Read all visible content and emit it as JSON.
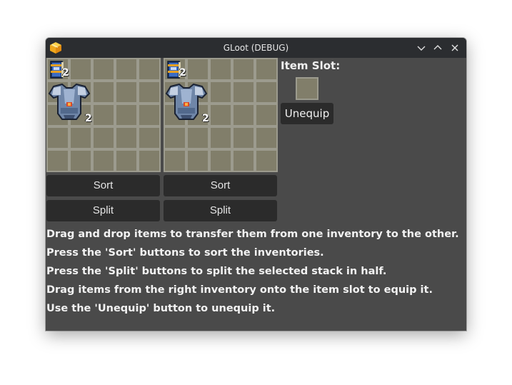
{
  "window": {
    "title": "GLoot (DEBUG)",
    "app_icon": "cube-icon",
    "controls": [
      "minimize-icon",
      "maximize-icon",
      "close-icon"
    ]
  },
  "inventories": {
    "left": {
      "columns": 5,
      "rows": 5,
      "items": [
        {
          "icon": "book-icon",
          "count": "2"
        },
        {
          "icon": "armor-icon",
          "count": "2"
        }
      ],
      "sort_label": "Sort",
      "split_label": "Split"
    },
    "right": {
      "columns": 5,
      "rows": 5,
      "items": [
        {
          "icon": "book-icon",
          "count": "2"
        },
        {
          "icon": "armor-icon",
          "count": "2"
        }
      ],
      "sort_label": "Sort",
      "split_label": "Split"
    }
  },
  "item_slot": {
    "label": "Item Slot:",
    "unequip_label": "Unequip"
  },
  "instructions": [
    "Drag and drop items to transfer them from one inventory to the other.",
    "Press the 'Sort' buttons to sort the inventories.",
    "Press the 'Split' buttons to split the selected stack in half.",
    "Drag items from the right inventory onto the item slot to equip it.",
    "Use the 'Unequip' button to unequip it."
  ],
  "colors": {
    "window_bg": "#4a4a4a",
    "titlebar_bg": "#2b2d30",
    "cell_bg": "#817e6a",
    "cell_border": "#9c9b8e",
    "button_bg": "#2b2b2b"
  }
}
